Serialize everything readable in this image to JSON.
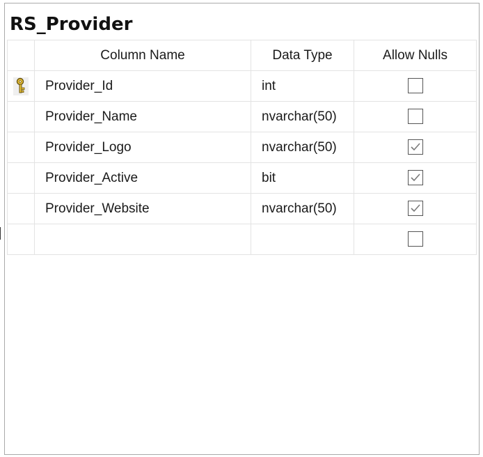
{
  "table": {
    "title": "RS_Provider",
    "columns": [
      "Column Name",
      "Data Type",
      "Allow Nulls"
    ],
    "rows": [
      {
        "name": "Provider_Id",
        "type": "int",
        "allow_nulls": false,
        "primary_key": true
      },
      {
        "name": "Provider_Name",
        "type": "nvarchar(50)",
        "allow_nulls": false,
        "primary_key": false
      },
      {
        "name": "Provider_Logo",
        "type": "nvarchar(50)",
        "allow_nulls": true,
        "primary_key": false
      },
      {
        "name": "Provider_Active",
        "type": "bit",
        "allow_nulls": true,
        "primary_key": false
      },
      {
        "name": "Provider_Website",
        "type": "nvarchar(50)",
        "allow_nulls": true,
        "primary_key": false
      },
      {
        "name": "",
        "type": "",
        "allow_nulls": false,
        "primary_key": false
      }
    ]
  },
  "icons": {
    "primary_key": "key-icon",
    "checkbox_checked": "checkmark-icon"
  },
  "colors": {
    "key_gold": "#d9b22b",
    "grid_line": "#e3e3e3",
    "check": "#7a7a7a"
  }
}
